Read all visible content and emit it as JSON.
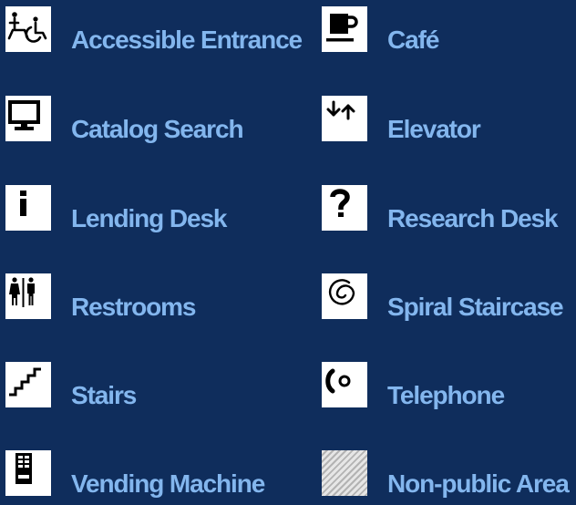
{
  "colors": {
    "background": "#0f2d5c",
    "label": "#83b6ee",
    "icon_background": "#ffffff",
    "icon_foreground": "#000000"
  },
  "legend": {
    "items": [
      {
        "label": "Accessible Entrance",
        "icon": "accessible-entrance-icon"
      },
      {
        "label": "Café",
        "icon": "cafe-icon"
      },
      {
        "label": "Catalog Search",
        "icon": "computer-icon"
      },
      {
        "label": "Elevator",
        "icon": "elevator-icon"
      },
      {
        "label": "Lending Desk",
        "icon": "info-icon"
      },
      {
        "label": "Research Desk",
        "icon": "question-icon"
      },
      {
        "label": "Restrooms",
        "icon": "restroom-icon"
      },
      {
        "label": "Spiral Staircase",
        "icon": "spiral-icon"
      },
      {
        "label": "Stairs",
        "icon": "stairs-icon"
      },
      {
        "label": "Telephone",
        "icon": "telephone-icon"
      },
      {
        "label": "Vending Machine",
        "icon": "vending-machine-icon"
      },
      {
        "label": "Non-public Area",
        "icon": "hatched-area-icon"
      }
    ]
  }
}
